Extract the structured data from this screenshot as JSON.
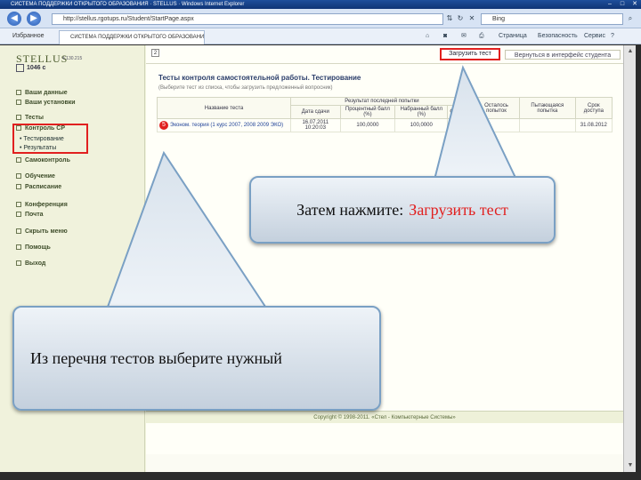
{
  "browser": {
    "title": "СИСТЕМА ПОДДЕРЖКИ ОТКРЫТОГО ОБРАЗОВАНИЯ · STELLUS · Windows Internet Explorer",
    "url": "http://stellus.rgotups.ru/Student/StartPage.aspx",
    "search_placeholder": "Bing",
    "favorites_label": "Избранное",
    "tab_label": "СИСТЕМА ПОДДЕРЖКИ ОТКРЫТОГО ОБРАЗОВАНИЯ",
    "tools": [
      "Страница",
      "Безопасность",
      "Сервис"
    ]
  },
  "sidebar": {
    "logo": "STELLUS",
    "version": "4.130.215",
    "user_id": "1046 с",
    "items": [
      {
        "label": "Ваши данные"
      },
      {
        "label": "Ваши установки"
      },
      {
        "label": "Тесты"
      },
      {
        "label": "Контроль СР"
      },
      {
        "label": "Самоконтроль"
      },
      {
        "label": "Обучение"
      },
      {
        "label": "Расписание"
      },
      {
        "label": "Конференция"
      },
      {
        "label": "Почта"
      },
      {
        "label": "Скрыть меню"
      },
      {
        "label": "Помощь"
      },
      {
        "label": "Выход"
      }
    ],
    "subitems": [
      {
        "label": "• Тестирование"
      },
      {
        "label": "• Результаты"
      }
    ]
  },
  "main": {
    "page_number": "2",
    "load_button": "Загрузить тест",
    "return_button": "Вернуться в интерфейс студента",
    "title": "Тесты контроля самостоятельной работы. Тестирование",
    "subtitle": "(Выберите тест из списка, чтобы загрузить предложенный вопросник)",
    "table": {
      "group_header": "Результат последней попытки",
      "headers": [
        "Название теста",
        "Дата сдачи",
        "Процентный балл (%)",
        "Набранный балл (%)",
        "Отметка",
        "Осталось попыток",
        "Пытающаяся попытка",
        "Срок доступа"
      ],
      "rows": [
        {
          "marker": "5",
          "name": "Эконом. теория (1 курс 2007, 2008 2009 ЭКО)",
          "date": "16.07.2011 10:20:03",
          "pct": "100,0000",
          "score": "100,0000",
          "mark": "отл.",
          "attempts": "",
          "current": "",
          "deadline": "31.08.2012"
        }
      ]
    }
  },
  "footer": "Copyright © 1998-2011. «Стел - Компьютерные Системы»",
  "callouts": {
    "first_prefix": "Затем нажмите:",
    "first_highlight": "Загрузить тест",
    "second": "Из перечня тестов выберите нужный"
  },
  "colors": {
    "highlight_red": "#e1201f",
    "callout_border": "#7aa0c4",
    "page_bg": "#f1f4dc"
  }
}
